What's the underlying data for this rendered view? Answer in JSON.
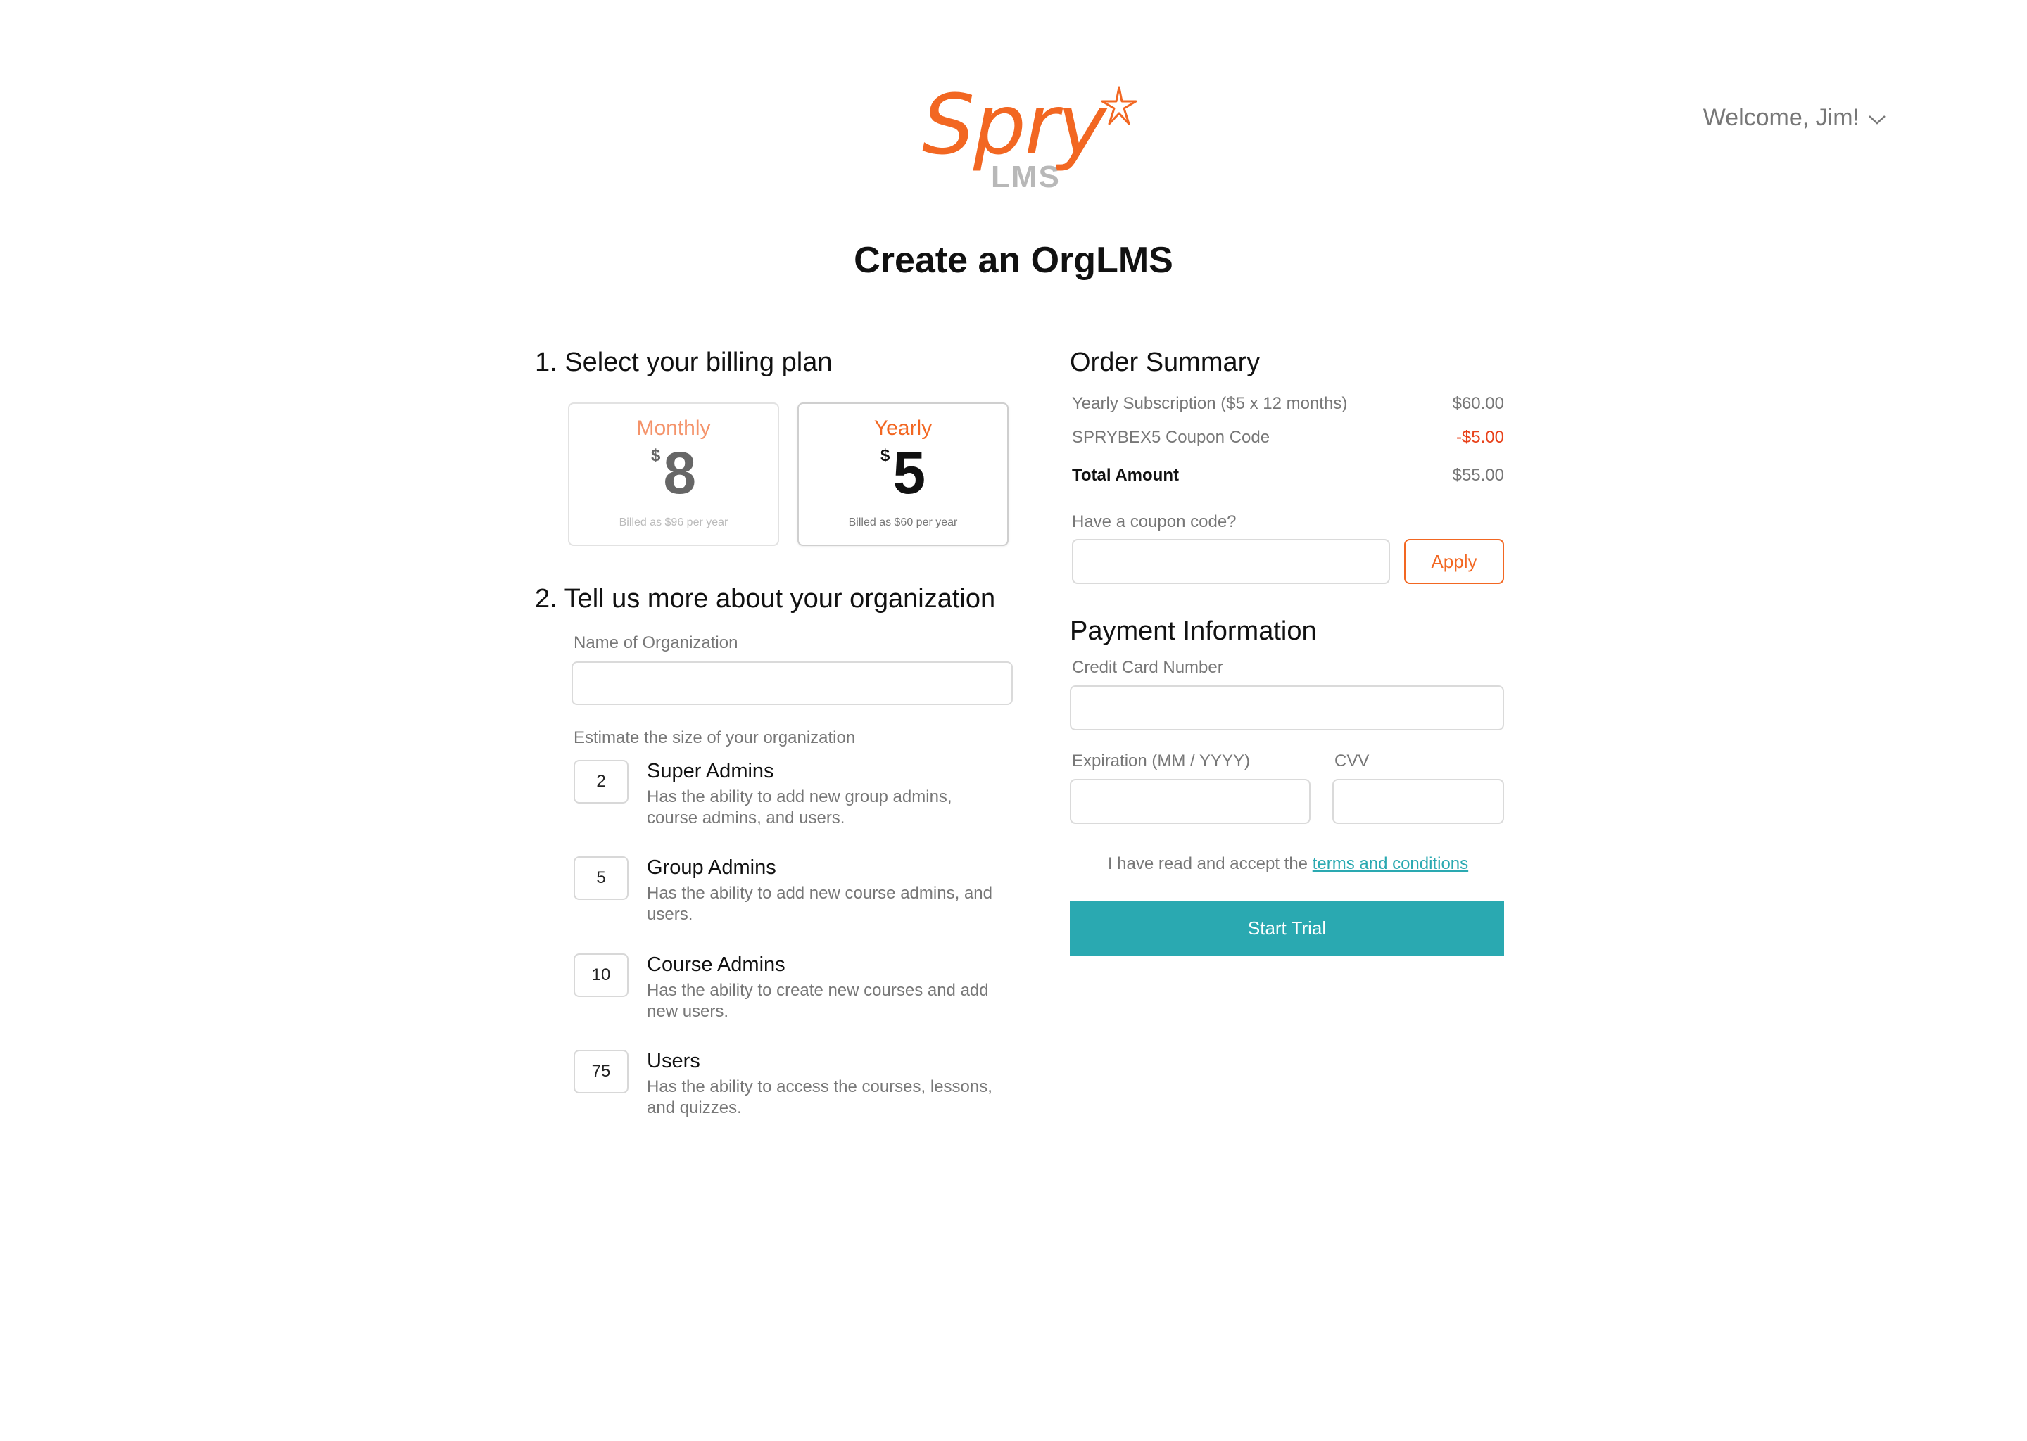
{
  "header": {
    "logo_word": "Spry",
    "logo_sub": "LMS",
    "welcome": "Welcome, Jim!"
  },
  "page_title": "Create an OrgLMS",
  "billing": {
    "heading": "1. Select your billing plan",
    "plans": [
      {
        "name": "Monthly",
        "currency": "$",
        "price": "8",
        "billed": "Billed as $96 per year",
        "selected": false
      },
      {
        "name": "Yearly",
        "currency": "$",
        "price": "5",
        "billed": "Billed as $60 per year",
        "selected": true
      }
    ]
  },
  "organization": {
    "heading": "2. Tell us more about your organization",
    "name_label": "Name of Organization",
    "name_value": "",
    "size_label": "Estimate the size of your organization",
    "roles": [
      {
        "count": "2",
        "title": "Super Admins",
        "desc": "Has the ability to add new group admins, course admins, and users."
      },
      {
        "count": "5",
        "title": "Group Admins",
        "desc": "Has the ability to add new course admins, and users."
      },
      {
        "count": "10",
        "title": "Course Admins",
        "desc": "Has the ability to create new courses and add new users."
      },
      {
        "count": "75",
        "title": "Users",
        "desc": "Has the ability to access the courses, lessons, and quizzes."
      }
    ]
  },
  "order_summary": {
    "heading": "Order Summary",
    "rows": [
      {
        "label": "Yearly Subscription  ($5 x 12 months)",
        "value": "$60.00"
      },
      {
        "label": "SPRYBEX5 Coupon Code",
        "value": "-$5.00"
      },
      {
        "label": "Total Amount",
        "value": "$55.00"
      }
    ],
    "coupon_label": "Have a coupon code?",
    "coupon_value": "",
    "apply_label": "Apply"
  },
  "payment": {
    "heading": "Payment Information",
    "card_label": "Credit Card Number",
    "card_value": "",
    "expiration_label": "Expiration (MM / YYYY)",
    "expiration_value": "",
    "cvv_label": "CVV",
    "cvv_value": "",
    "terms_prefix": "I have read and accept the ",
    "terms_link": "terms and conditions",
    "start_label": "Start Trial"
  },
  "colors": {
    "brand_orange": "#f26722",
    "accent_teal": "#2aa9b1",
    "negative_red": "#e8421b",
    "logo_gray": "#b8b8b8"
  }
}
